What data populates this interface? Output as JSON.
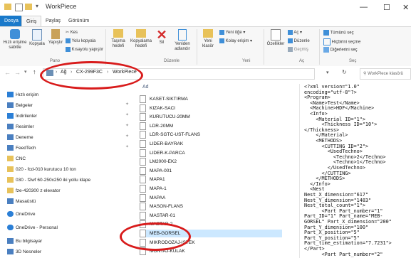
{
  "window": {
    "title": "WorkPiece",
    "min": "—",
    "max": "☐",
    "close": "✕"
  },
  "tabs": [
    "Dosya",
    "Giriş",
    "Paylaş",
    "Görünüm"
  ],
  "ribbon": {
    "pin": "Hızlı erişime sabitle",
    "copy": "Kopyala",
    "paste": "Yapıştır",
    "cut": "Kes",
    "copy_path": "Yolu kopyala",
    "paste_shortcut": "Kısayolu yapıştır",
    "move": "Taşıma hedefi",
    "copyto": "Kopyalama hedefi",
    "delete": "Sil",
    "rename": "Yeniden adlandır",
    "newfolder": "Yeni klasör",
    "newitem": "Yeni öğe",
    "easyaccess": "Kolay erişim",
    "properties": "Özellikler",
    "open": "Aç",
    "edit": "Düzenle",
    "history": "Geçmiş",
    "selectall": "Tümünü seç",
    "selectnone": "Hiçbirini seçme",
    "invert": "Diğerlerini seç",
    "groups": [
      "Pano",
      "Düzenle",
      "Yeni",
      "Aç",
      "Seç"
    ]
  },
  "address": {
    "crumbs": [
      "Ağ",
      "CX-299F3C",
      "WorkPiece"
    ],
    "sep": "›",
    "search_placeholder": "WorkPiece klasörü"
  },
  "nav": [
    {
      "label": "Hızlı erişim",
      "color": "#2b7fd6"
    },
    {
      "label": "Belgeler",
      "color": "#4a7fc0"
    },
    {
      "label": "İndirilenler",
      "color": "#2b7fd6"
    },
    {
      "label": "Resimler",
      "color": "#4a7fc0"
    },
    {
      "label": "Deneme",
      "color": "#4a7fc0"
    },
    {
      "label": "FeedTech",
      "color": "#4a7fc0"
    },
    {
      "label": "CNC",
      "color": "#e8c25a"
    },
    {
      "label": "020 - fcd-010 kurutucu 10 ton",
      "color": "#e8c25a"
    },
    {
      "label": "030 - f2wf 60-250x250 iki yollu klape",
      "color": "#e8c25a"
    },
    {
      "label": "fze-420300 z elevator",
      "color": "#e8c25a"
    },
    {
      "label": "Masaüstü",
      "color": "#4a7fc0"
    },
    {
      "label": "OneDrive",
      "color": "#2b7fd6"
    },
    {
      "label": "OneDrive - Personal",
      "color": "#2b7fd6"
    },
    {
      "label": "Bu bilgisayar",
      "color": "#4a7fc0"
    },
    {
      "label": "3D Nesneler",
      "color": "#4a7fc0"
    }
  ],
  "list": {
    "column": "Ad",
    "files": [
      "KASET-SIKTIRMA",
      "KIZAK-SACI",
      "KURUTUCU-20MM",
      "LDR-20MM",
      "LDR-SGTC-UST-FLANS",
      "LIDER-BAYRAK",
      "LIDER-K-PARCA",
      "LM2000-EK2",
      "MAPA-001",
      "MAPA1",
      "MAPA-1",
      "MAPAA",
      "MASON-FLANS",
      "MASTAR-01",
      "MASTAR-2",
      "MEB-GORSEL",
      "MIKRODOZAJ-ISTEK",
      "MONTAJ-KULAK"
    ],
    "selected_index": 15
  },
  "preview": {
    "lines": [
      "<?xml version=\"1.0\"",
      "encoding=\"utf-8\"?>",
      "<Program>",
      "  <Name>Test</Name>",
      "  <Machine>HDF</Machine>",
      "  <Info>",
      "    <Material ID=\"1\">",
      "      <Thickness ID=\"10\">",
      "</Thickness>",
      "    </Material>",
      "    <METHODS>",
      "      <CUTTING ID=\"2\">",
      "        <UsedTechno>",
      "          <Techno>2</Techno>",
      "          <Techno>1</Techno>",
      "        </UsedTechno>",
      "      </CUTTING>",
      "    </METHODS>",
      "  </Info>",
      "  <Nest",
      "Nest_X_dimension=\"617\"",
      "Nest_Y_dimension=\"1483\"",
      "Nest_total_count=\"1\">",
      "      <Part Part_number=\"1\"",
      "Part_ID=\"1\" Part_name=\"MEB-",
      "GORSEL\" Part_X_dimension=\"200\"",
      "Part_Y_dimension=\"100\"",
      "Part_X_position=\"5\"",
      "Part_Y_position=\"5\"",
      "Part_time_estimation=\"7.7231\">",
      "</Part>",
      "      <Part Part_number=\"2\""
    ]
  }
}
